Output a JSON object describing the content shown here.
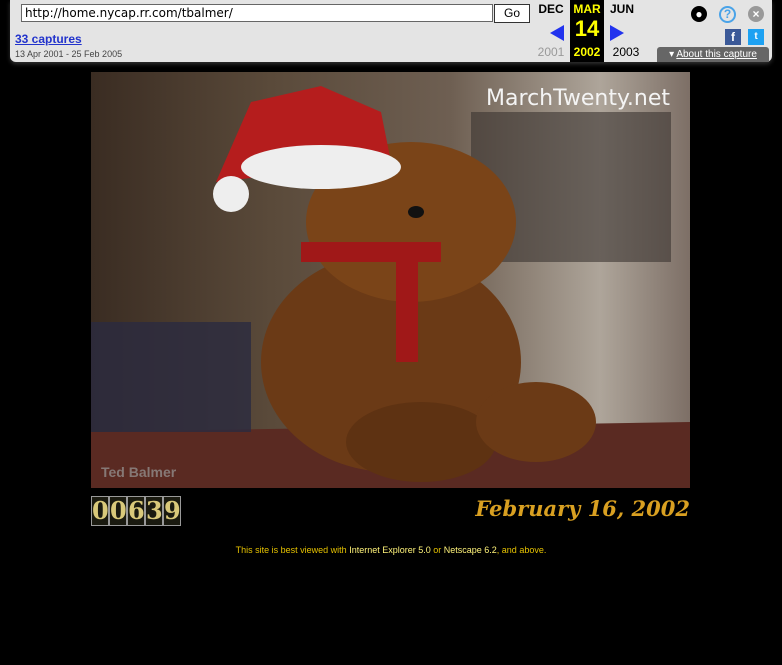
{
  "wayback": {
    "url": "http://home.nycap.rr.com/tbalmer/",
    "go_label": "Go",
    "captures_label": "33 captures",
    "date_range": "13 Apr 2001 - 25 Feb 2005",
    "months": {
      "prev": "DEC",
      "current": "MAR",
      "next": "JUN"
    },
    "day": "14",
    "years": {
      "prev": "2001",
      "current": "2002",
      "next": "2003"
    },
    "about_label": "About this capture",
    "icons": [
      "user-icon",
      "help-icon",
      "close-icon",
      "facebook-icon",
      "twitter-icon"
    ]
  },
  "page": {
    "photo_watermark": "MarchTwenty.net",
    "photo_signature": "Ted Balmer",
    "counter_digits": [
      "0",
      "0",
      "6",
      "3",
      "9"
    ],
    "date": "February 16, 2002",
    "note": {
      "pre": "This site is best viewed with ",
      "ie": "Internet Explorer 5.0",
      "mid": " or ",
      "ns": "Netscape 6.2",
      "post": ", and above."
    }
  }
}
